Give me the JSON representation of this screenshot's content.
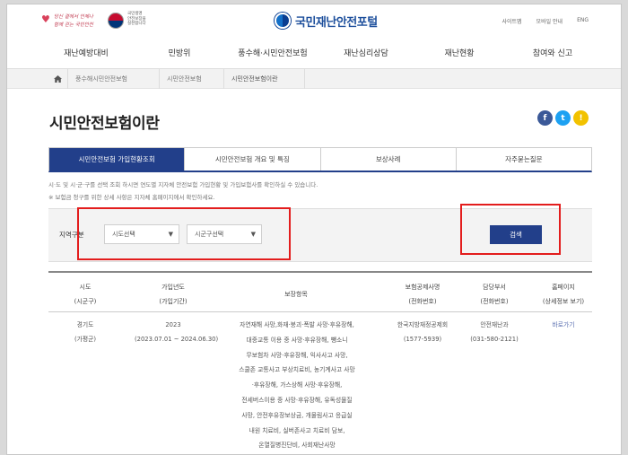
{
  "header": {
    "slogan_lines": [
      "당신 곁에서 언제나",
      "함께 걷는 국민안전"
    ],
    "gov_text": [
      "국민생명",
      "안전보장을",
      "실천합니다"
    ],
    "portal_name": "국민재난안전포털",
    "top_links": [
      "사이트맵",
      "모바일 안내",
      "ENG"
    ]
  },
  "nav": {
    "items": [
      "재난예방대비",
      "민방위",
      "풍수해·시민안전보험",
      "재난심리상담",
      "재난현황",
      "참여와 신고"
    ]
  },
  "breadcrumb": [
    "풍수해시민안전보험",
    "시민안전보험",
    "시민안전보험이란"
  ],
  "page": {
    "title": "시민안전보험이란",
    "sns": [
      {
        "glyph": "f",
        "color": "#3b5998"
      },
      {
        "glyph": "t",
        "color": "#1da1f2"
      },
      {
        "glyph": "!",
        "color": "#f2c200"
      }
    ]
  },
  "tabs": [
    "시민안전보험 가입현황조회",
    "시민안전보험 개요 및 특징",
    "보상사례",
    "자주묻는질문"
  ],
  "notices": [
    "시·도 및 시·군·구를 선택 조회 하시면 연도별 지자체 안전보험 가입현황 및 가입보험사를 확인하실 수 있습니다.",
    "※ 보험금 청구를 위한 상세 사항은 지자체 홈페이지에서 확인하세요."
  ],
  "search": {
    "label": "지역구분",
    "sido_placeholder": "시도선택",
    "sigungu_placeholder": "시군구선택",
    "button_label": "검색"
  },
  "table": {
    "headers": [
      [
        "시도",
        "(시군구)"
      ],
      [
        "가입년도",
        "(가입기간)"
      ],
      [
        "보장항목",
        ""
      ],
      [
        "보험공제사명",
        "(전화번호)"
      ],
      [
        "담당부서",
        "(전화번호)"
      ],
      [
        "홈페이지",
        "(상세정보 보기)"
      ]
    ],
    "rows": [
      {
        "region": [
          "경기도",
          "(가평군)"
        ],
        "year": [
          "2023",
          "(2023.07.01 ~ 2024.06.30)"
        ],
        "benefits": [
          "자연재해 사망,화재·붕괴·폭발 사망·후유장해,",
          "대중교통 이용 중 사망·후유장해, 뺑소니",
          "무보험차 사망·후유장해, 익사사고 사망,",
          "스쿨존 교통사고 부상치료비, 농기계사고 사망",
          "·후유장해, 가스상해 사망·후유장해,",
          "전세버스이용 중 사망·후유장해, 유독성물질",
          "사망, 안전후유장보상금, 개물림사고 응급실",
          "내원 치료비, 실버존사고 치료비 담보,",
          "온열질병진단비, 사회재난사망"
        ],
        "insurer": [
          "한국지방재정공제회",
          "(1577-5939)"
        ],
        "dept": [
          "안전재난과",
          "(031-580-2121)"
        ],
        "link": "바로가기"
      }
    ]
  },
  "highlight_color": "#e31d1d"
}
